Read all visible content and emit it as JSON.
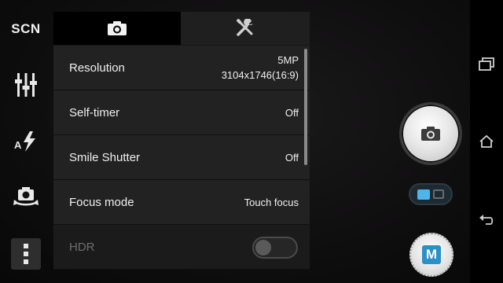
{
  "left_bar": {
    "scene_label": "SCN",
    "items": [
      {
        "icon": "scene-icon"
      },
      {
        "icon": "sliders-icon"
      },
      {
        "icon": "auto-flash-icon"
      },
      {
        "icon": "switch-camera-icon"
      },
      {
        "icon": "more-vertical-icon"
      }
    ]
  },
  "panel": {
    "tabs": [
      {
        "icon": "camera-icon",
        "selected": true
      },
      {
        "icon": "tools-icon",
        "selected": false
      }
    ],
    "rows": [
      {
        "label": "Resolution",
        "value_line1": "5MP",
        "value_line2": "3104x1746(16:9)"
      },
      {
        "label": "Self-timer",
        "value": "Off"
      },
      {
        "label": "Smile Shutter",
        "value": "Off"
      },
      {
        "label": "Focus mode",
        "value": "Touch focus"
      },
      {
        "label": "HDR",
        "toggle": false,
        "enabled": false
      }
    ]
  },
  "right_controls": {
    "shutter_icon": "camera-icon",
    "mode": "photo",
    "manual_label": "M"
  },
  "nav_bar": {
    "items": [
      "recent-apps-icon",
      "home-icon",
      "back-icon"
    ]
  },
  "colors": {
    "accent": "#4fb5e8",
    "manual_blue": "#2d8fc7",
    "panel_row": "#222222"
  }
}
